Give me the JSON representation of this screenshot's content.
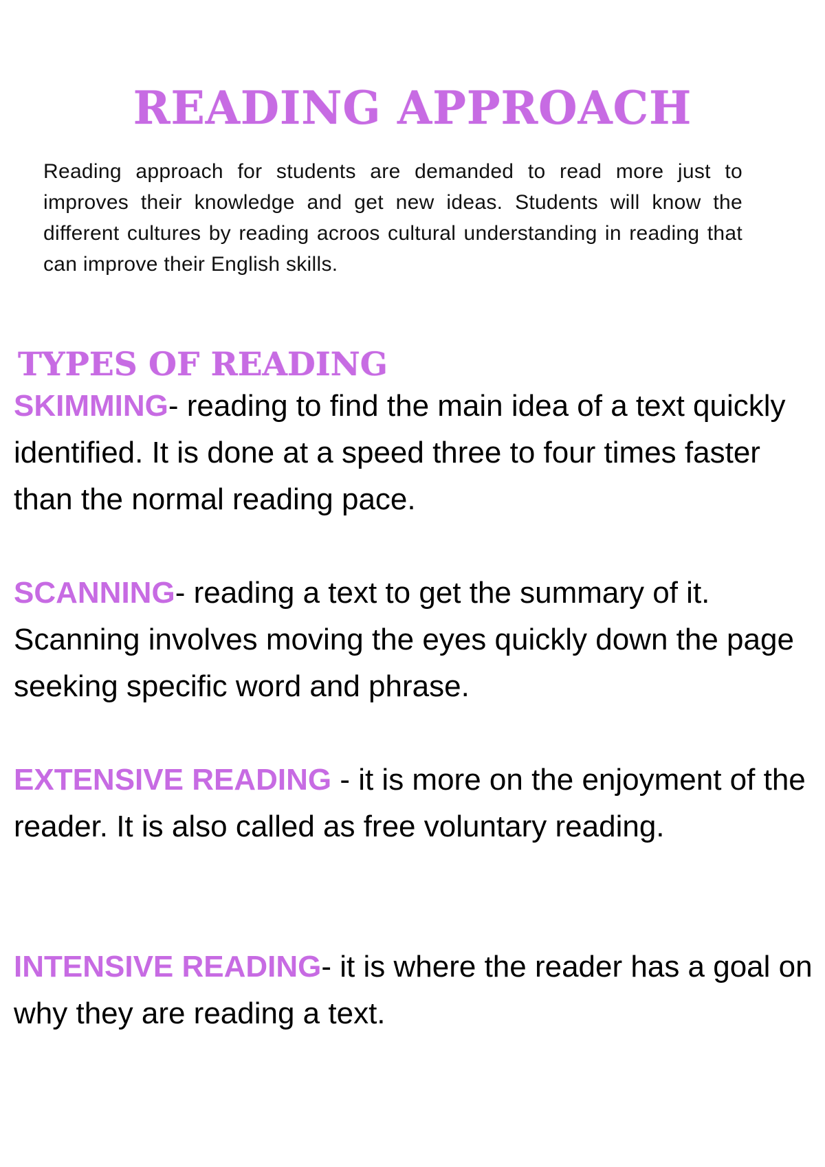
{
  "page": {
    "title": "READING APPROACH",
    "intro": "Reading approach for students are demanded to read more just to improves their knowledge and get new ideas. Students will know the different cultures by reading acroos cultural understanding in reading that can improve their English skills.",
    "section_heading": "TYPES OF READING",
    "accent_color": "#c76be3",
    "text_color": "#000000"
  },
  "types": [
    {
      "term": "SKIMMING",
      "separator": "- ",
      "description": "reading to find the main idea of a text quickly identified. It is done at a speed three to four times faster than the normal reading pace."
    },
    {
      "term": "SCANNING",
      "separator": "- ",
      "description": "reading a text to get the summary of it. Scanning involves moving the eyes quickly down the page seeking specific word and phrase."
    },
    {
      "term": "EXTENSIVE READING",
      "separator": " - ",
      "description": "it is more on the enjoyment of the reader. It is also called as free voluntary reading."
    },
    {
      "term": "INTENSIVE READING",
      "separator": "- ",
      "description": "it is where the reader has a goal on why they are reading a text."
    }
  ]
}
